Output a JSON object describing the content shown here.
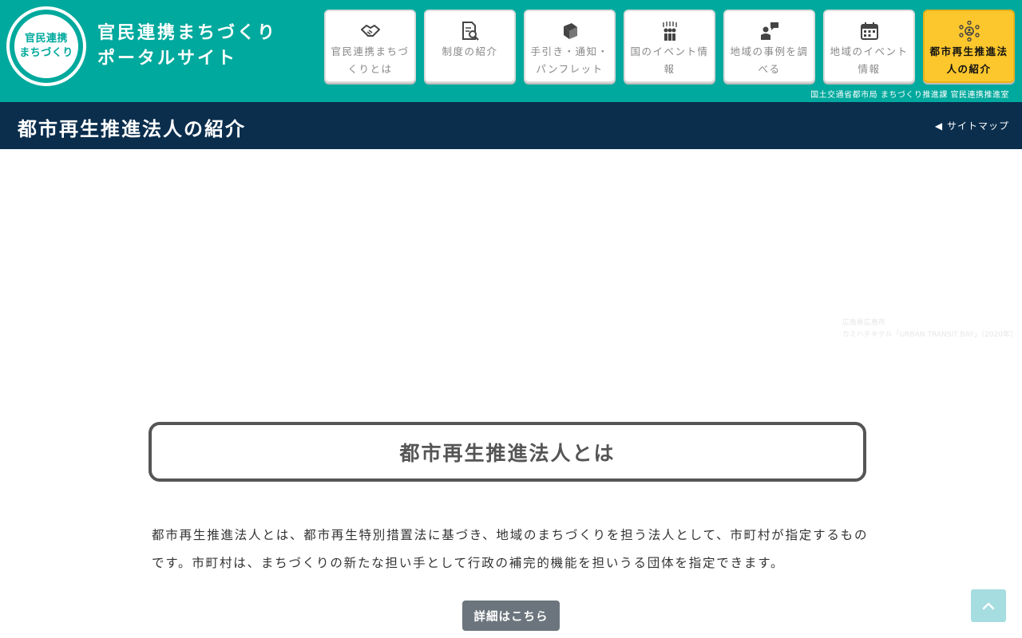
{
  "header": {
    "logo_line1": "官民連携",
    "logo_line2": "まちづくり",
    "title_line1": "官民連携まちづくり",
    "title_line2": "ポータルサイト",
    "ministry": "国土交通省都市局 まちづくり推進課 官民連携推進室"
  },
  "nav": {
    "items": [
      {
        "label": "官民連携まちづくりとは",
        "icon": "handshake-icon"
      },
      {
        "label": "制度の紹介",
        "icon": "document-search-icon"
      },
      {
        "label": "手引き・通知・パンフレット",
        "icon": "book-icon"
      },
      {
        "label": "国のイベント情報",
        "icon": "cheering-people-icon"
      },
      {
        "label": "地域の事例を調べる",
        "icon": "chat-person-icon"
      },
      {
        "label": "地域のイベント情報",
        "icon": "calendar-icon"
      },
      {
        "label": "都市再生推進法人の紹介",
        "icon": "people-network-icon",
        "active": true
      }
    ]
  },
  "titlebar": {
    "title": "都市再生推進法人の紹介",
    "sitemap": "サイトマップ",
    "sitemap_arrow": "◀"
  },
  "hero": {
    "caption_line1": "広島県広島市",
    "caption_line2": "カミハチキテル「URBAN TRANSIT BAY」（2020年）"
  },
  "section": {
    "title": "都市再生推進法人とは",
    "description": "都市再生推進法人とは、都市再生特別措置法に基づき、地域のまちづくりを担う法人として、市町村が指定するものです。市町村は、まちづくりの新たな担い手として行政の補完的機能を担いうる団体を指定できます。",
    "button": "詳細はこちら"
  },
  "colors": {
    "header_bg": "#00a99d",
    "titlebar_bg": "#0b2e4d",
    "active_nav": "#fcc62d",
    "button_bg": "#6c757d",
    "top_button": "#a6dde0"
  }
}
